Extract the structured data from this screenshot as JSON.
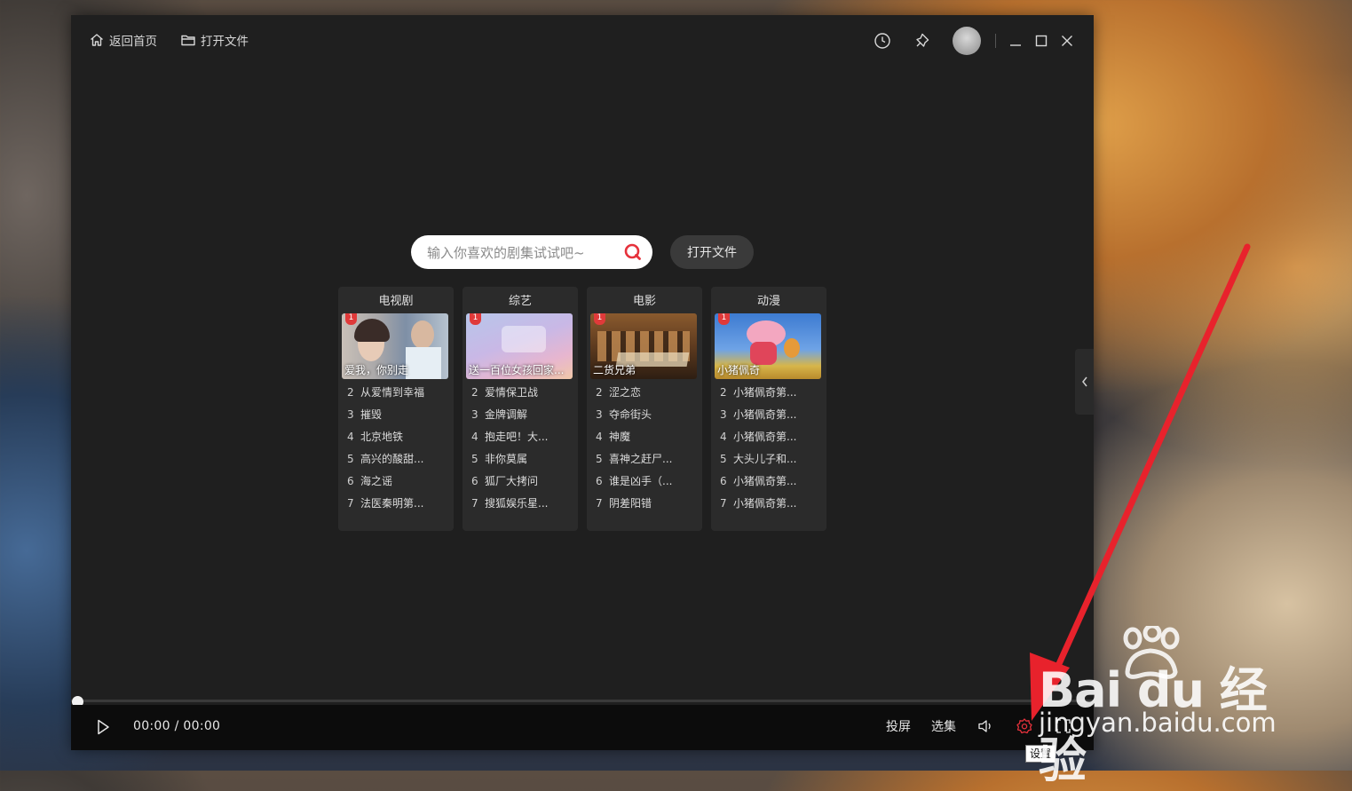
{
  "titlebar": {
    "home_label": "返回首页",
    "open_label": "打开文件"
  },
  "search": {
    "placeholder": "输入你喜欢的剧集试试吧~",
    "open_file_label": "打开文件"
  },
  "categories": [
    {
      "title": "电视剧",
      "featured": {
        "rank": "1",
        "caption": "爱我，你别走"
      },
      "items": [
        {
          "n": "2",
          "t": "从爱情到幸福"
        },
        {
          "n": "3",
          "t": "摧毁"
        },
        {
          "n": "4",
          "t": "北京地铁"
        },
        {
          "n": "5",
          "t": "高兴的酸甜..."
        },
        {
          "n": "6",
          "t": "海之谣"
        },
        {
          "n": "7",
          "t": "法医秦明第..."
        }
      ]
    },
    {
      "title": "综艺",
      "featured": {
        "rank": "1",
        "caption": "送一百位女孩回家..."
      },
      "items": [
        {
          "n": "2",
          "t": "爱情保卫战"
        },
        {
          "n": "3",
          "t": "金牌调解"
        },
        {
          "n": "4",
          "t": "抱走吧！大..."
        },
        {
          "n": "5",
          "t": "非你莫属"
        },
        {
          "n": "6",
          "t": "狐厂大拷问"
        },
        {
          "n": "7",
          "t": "搜狐娱乐星..."
        }
      ]
    },
    {
      "title": "电影",
      "featured": {
        "rank": "1",
        "caption": "二货兄弟"
      },
      "items": [
        {
          "n": "2",
          "t": "涩之恋"
        },
        {
          "n": "3",
          "t": "夺命街头"
        },
        {
          "n": "4",
          "t": "神魔"
        },
        {
          "n": "5",
          "t": "喜神之赶尸..."
        },
        {
          "n": "6",
          "t": "谁是凶手（..."
        },
        {
          "n": "7",
          "t": "阴差阳错"
        }
      ]
    },
    {
      "title": "动漫",
      "featured": {
        "rank": "1",
        "caption": "小猪佩奇"
      },
      "items": [
        {
          "n": "2",
          "t": "小猪佩奇第..."
        },
        {
          "n": "3",
          "t": "小猪佩奇第..."
        },
        {
          "n": "4",
          "t": "小猪佩奇第..."
        },
        {
          "n": "5",
          "t": "大头儿子和..."
        },
        {
          "n": "6",
          "t": "小猪佩奇第..."
        },
        {
          "n": "7",
          "t": "小猪佩奇第..."
        }
      ]
    }
  ],
  "player": {
    "current_time": "00:00",
    "separator": "/",
    "total_time": "00:00",
    "progress": 0,
    "cast_label": "投屏",
    "episodes_label": "选集",
    "settings_tooltip": "设置"
  },
  "watermark": {
    "logo_text": "Bai du 经验",
    "url": "jingyan.baidu.com"
  },
  "icons": [
    "home-icon",
    "folder-icon",
    "history-icon",
    "pin-icon",
    "avatar",
    "minimize-icon",
    "maximize-icon",
    "close-icon",
    "search-icon",
    "chevron-left-icon",
    "play-icon",
    "volume-icon",
    "settings-icon",
    "fullscreen-icon"
  ],
  "colors": {
    "accent": "#e6323c",
    "window_bg": "#1f1f1f",
    "card_bg": "#2b2b2b",
    "control_bar": "#0c0c0c",
    "arrow": "#e8222c"
  }
}
